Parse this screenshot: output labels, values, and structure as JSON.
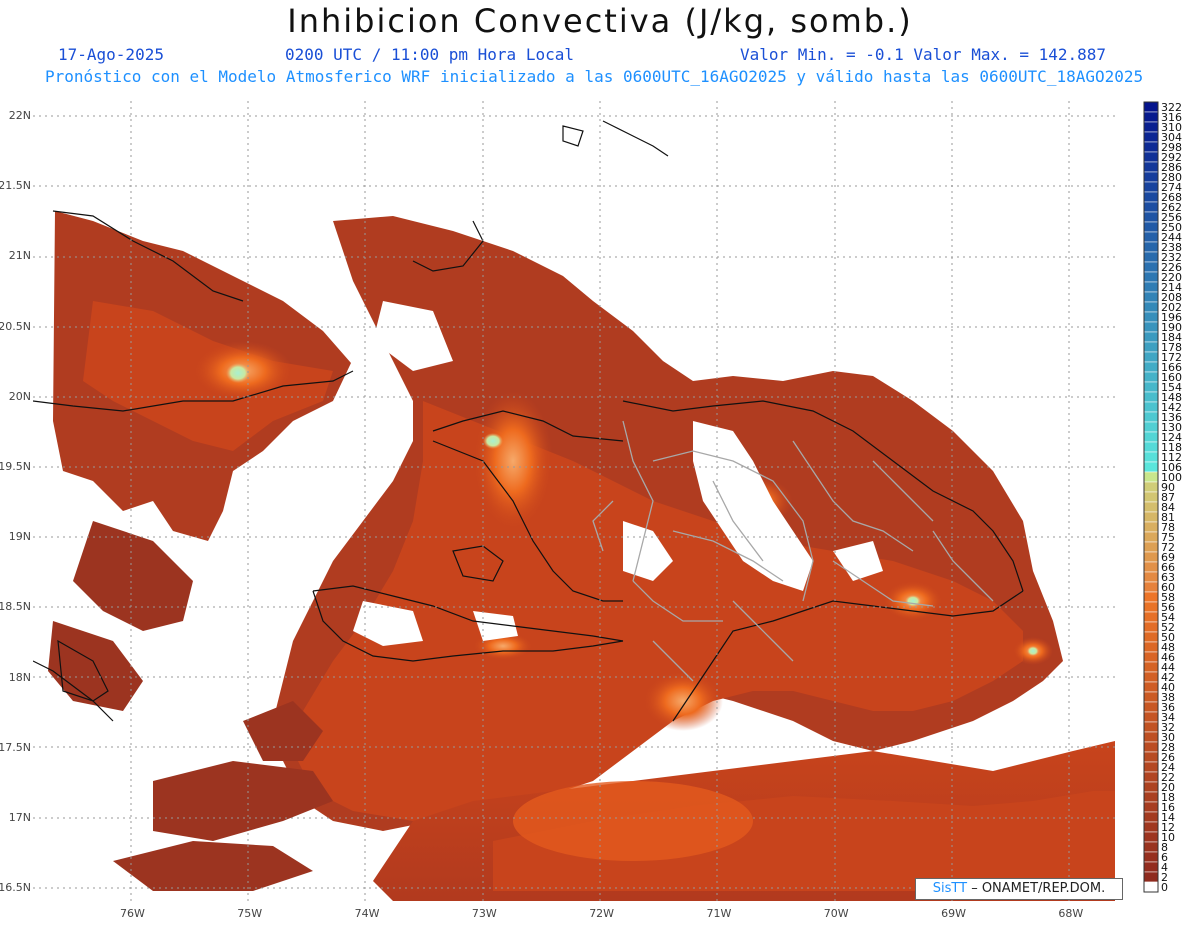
{
  "header": {
    "title": "Inhibicion Convectiva (J/kg, somb.)",
    "date": "17-Ago-2025",
    "time": "0200 UTC / 11:00 pm Hora Local",
    "min_max": "Valor Min. = -0.1  Valor Max. = 142.887",
    "model_info": "Pronóstico con el Modelo Atmosferico WRF inicializado a las 0600UTC_16AGO2025 y válido hasta las  0600UTC_18AGO2025"
  },
  "map": {
    "lat_labels": [
      "22N",
      "21.5N",
      "21N",
      "20.5N",
      "20N",
      "19.5N",
      "19N",
      "18.5N",
      "18N",
      "17.5N",
      "17N",
      "16.5N"
    ],
    "lon_labels": [
      "76W",
      "75W",
      "74W",
      "73W",
      "72W",
      "71W",
      "70W",
      "69W",
      "68W"
    ],
    "field_colors": {
      "low": "#8b2e22",
      "mid": "#c8441c",
      "high": "#ee6a1e",
      "peak": "#f3a060",
      "max": "#a8f0d0",
      "missing": "#ffffff"
    }
  },
  "colorbar": {
    "labels": [
      "322",
      "316",
      "310",
      "304",
      "298",
      "292",
      "286",
      "280",
      "274",
      "268",
      "262",
      "256",
      "250",
      "244",
      "238",
      "232",
      "226",
      "220",
      "214",
      "208",
      "202",
      "196",
      "190",
      "184",
      "178",
      "172",
      "166",
      "160",
      "154",
      "148",
      "142",
      "136",
      "130",
      "124",
      "118",
      "112",
      "106",
      "100",
      "90",
      "87",
      "84",
      "81",
      "78",
      "75",
      "72",
      "69",
      "66",
      "63",
      "60",
      "58",
      "56",
      "54",
      "52",
      "50",
      "48",
      "46",
      "44",
      "42",
      "40",
      "38",
      "36",
      "34",
      "32",
      "30",
      "28",
      "26",
      "24",
      "22",
      "20",
      "18",
      "16",
      "14",
      "12",
      "10",
      "8",
      "6",
      "4",
      "2",
      "0"
    ]
  },
  "credit": {
    "brand": "SisTT",
    "text": " – ONAMET/REP.DOM."
  }
}
